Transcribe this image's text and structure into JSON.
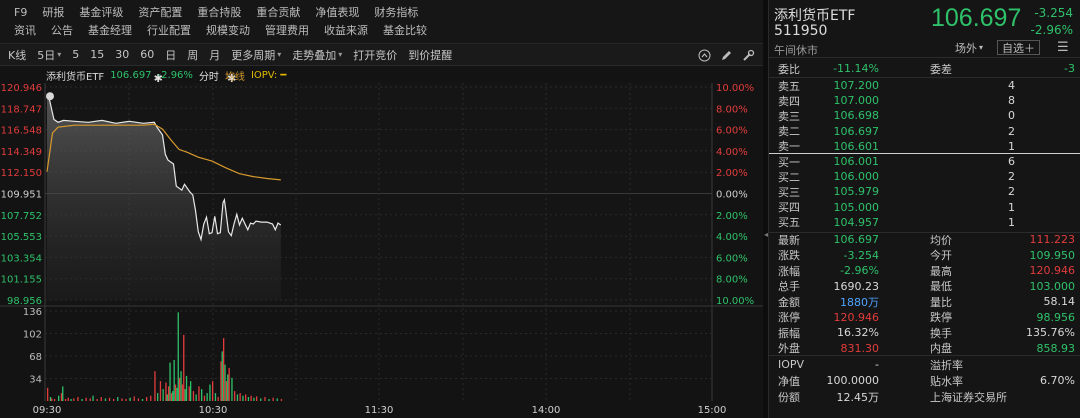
{
  "menu": {
    "row1": [
      "F9",
      "研报",
      "基金评级",
      "资产配置",
      "重合持股",
      "重合贡献",
      "净值表现",
      "财务指标"
    ],
    "row2": [
      "资讯",
      "公告",
      "基金经理",
      "行业配置",
      "规模变动",
      "管理费用",
      "收益来源",
      "基金比较"
    ]
  },
  "toolbar": {
    "items": [
      "K线",
      "5日",
      "5",
      "15",
      "30",
      "60",
      "日",
      "周",
      "月",
      "更多周期",
      "走势叠加",
      "打开竞价",
      "到价提醒"
    ],
    "icons": [
      "up-circle-icon",
      "draw-pen-icon",
      "settings-icon"
    ]
  },
  "chart": {
    "title": "添利货币ETF",
    "price": "106.697",
    "pct": "-2.96%",
    "mode": "分时",
    "avg_label": "均线",
    "iopv_label": "IOPV: ━",
    "y_left": [
      "120.946",
      "118.747",
      "116.548",
      "114.349",
      "112.150",
      "109.951",
      "107.752",
      "105.553",
      "103.354",
      "101.155",
      "98.956"
    ],
    "y_right": [
      "10.00%",
      "8.00%",
      "6.00%",
      "4.00%",
      "2.00%",
      "0.00%",
      "2.00%",
      "4.00%",
      "6.00%",
      "8.00%",
      "10.00%"
    ],
    "vol_axis": [
      "136",
      "102",
      "68",
      "34"
    ],
    "x_labels": [
      "09:30",
      "10:30",
      "11:30",
      "14:00",
      "15:00"
    ],
    "colors": {
      "price_line": "#e8e8e8",
      "avg_line": "#d79a2c",
      "up": "#e23c3c",
      "down": "#2fc16a",
      "grid": "#2a2a2a"
    }
  },
  "chart_data": {
    "type": "line",
    "title": "添利货币ETF",
    "x_labels": [
      "09:30",
      "10:30",
      "11:30",
      "14:00",
      "15:00"
    ],
    "ylim": [
      98.956,
      120.946
    ],
    "prev_close": 109.951,
    "series": [
      {
        "name": "分时",
        "points": [
          [
            0,
            120.2
          ],
          [
            2,
            119.5
          ],
          [
            5,
            117.6
          ],
          [
            8,
            117.3
          ],
          [
            12,
            117.5
          ],
          [
            20,
            117.4
          ],
          [
            30,
            117.3
          ],
          [
            40,
            117.5
          ],
          [
            50,
            117.2
          ],
          [
            60,
            117.4
          ],
          [
            70,
            117.2
          ],
          [
            78,
            117.3
          ],
          [
            80,
            116.8
          ],
          [
            84,
            116.0
          ],
          [
            86,
            114.0
          ],
          [
            88,
            113.4
          ],
          [
            92,
            113.0
          ],
          [
            94,
            110.7
          ],
          [
            98,
            110.3
          ],
          [
            100,
            110.9
          ],
          [
            104,
            110.1
          ],
          [
            106,
            109.8
          ],
          [
            108,
            108.2
          ],
          [
            110,
            106.0
          ],
          [
            112,
            105.2
          ],
          [
            114,
            106.8
          ],
          [
            116,
            107.5
          ],
          [
            118,
            105.8
          ],
          [
            120,
            105.9
          ],
          [
            122,
            107.6
          ],
          [
            124,
            105.8
          ],
          [
            126,
            105.9
          ],
          [
            128,
            109.0
          ],
          [
            129,
            109.3
          ],
          [
            130,
            108.2
          ],
          [
            132,
            106.0
          ],
          [
            134,
            105.6
          ],
          [
            136,
            106.8
          ],
          [
            138,
            107.8
          ],
          [
            140,
            106.7
          ],
          [
            142,
            107.4
          ],
          [
            144,
            106.8
          ],
          [
            146,
            106.2
          ],
          [
            148,
            106.9
          ],
          [
            150,
            106.8
          ],
          [
            152,
            107.1
          ],
          [
            156,
            107.0
          ],
          [
            160,
            107.0
          ],
          [
            164,
            106.8
          ],
          [
            166,
            106.2
          ],
          [
            168,
            106.9
          ],
          [
            170,
            106.7
          ]
        ]
      },
      {
        "name": "均线",
        "points": [
          [
            0,
            112.2
          ],
          [
            4,
            116.2
          ],
          [
            8,
            116.8
          ],
          [
            20,
            117.0
          ],
          [
            40,
            117.0
          ],
          [
            60,
            117.0
          ],
          [
            70,
            117.0
          ],
          [
            78,
            117.1
          ],
          [
            84,
            116.6
          ],
          [
            90,
            115.5
          ],
          [
            96,
            114.5
          ],
          [
            102,
            114.2
          ],
          [
            110,
            113.7
          ],
          [
            120,
            113.3
          ],
          [
            130,
            112.6
          ],
          [
            140,
            112.0
          ],
          [
            150,
            111.7
          ],
          [
            160,
            111.5
          ],
          [
            170,
            111.35
          ]
        ]
      }
    ],
    "volume": {
      "ylim": [
        0,
        136
      ],
      "bars": [
        [
          0,
          20,
          "up"
        ],
        [
          2,
          6,
          "down"
        ],
        [
          3,
          4,
          "up"
        ],
        [
          5,
          3,
          "up"
        ],
        [
          8,
          8,
          "down"
        ],
        [
          10,
          12,
          "up"
        ],
        [
          11,
          22,
          "down"
        ],
        [
          13,
          3,
          "up"
        ],
        [
          15,
          5,
          "up"
        ],
        [
          17,
          3,
          "down"
        ],
        [
          19,
          4,
          "up"
        ],
        [
          22,
          6,
          "up"
        ],
        [
          25,
          3,
          "down"
        ],
        [
          28,
          5,
          "up"
        ],
        [
          31,
          4,
          "up"
        ],
        [
          33,
          8,
          "down"
        ],
        [
          36,
          3,
          "up"
        ],
        [
          39,
          6,
          "up"
        ],
        [
          42,
          4,
          "down"
        ],
        [
          45,
          5,
          "up"
        ],
        [
          48,
          3,
          "up"
        ],
        [
          51,
          6,
          "down"
        ],
        [
          54,
          4,
          "up"
        ],
        [
          57,
          3,
          "up"
        ],
        [
          60,
          5,
          "down"
        ],
        [
          63,
          7,
          "up"
        ],
        [
          66,
          4,
          "up"
        ],
        [
          69,
          3,
          "down"
        ],
        [
          72,
          6,
          "up"
        ],
        [
          75,
          8,
          "up"
        ],
        [
          78,
          45,
          "up"
        ],
        [
          80,
          12,
          "down"
        ],
        [
          82,
          30,
          "up"
        ],
        [
          84,
          18,
          "down"
        ],
        [
          86,
          28,
          "up"
        ],
        [
          87,
          10,
          "down"
        ],
        [
          88,
          22,
          "up"
        ],
        [
          89,
          58,
          "down"
        ],
        [
          90,
          12,
          "up"
        ],
        [
          91,
          15,
          "down"
        ],
        [
          92,
          62,
          "down"
        ],
        [
          93,
          25,
          "up"
        ],
        [
          94,
          20,
          "down"
        ],
        [
          95,
          134,
          "down"
        ],
        [
          96,
          35,
          "up"
        ],
        [
          97,
          45,
          "down"
        ],
        [
          98,
          25,
          "up"
        ],
        [
          99,
          100,
          "up"
        ],
        [
          100,
          18,
          "down"
        ],
        [
          101,
          38,
          "down"
        ],
        [
          103,
          22,
          "up"
        ],
        [
          104,
          30,
          "down"
        ],
        [
          106,
          15,
          "up"
        ],
        [
          108,
          10,
          "down"
        ],
        [
          110,
          22,
          "up"
        ],
        [
          112,
          18,
          "down"
        ],
        [
          114,
          8,
          "up"
        ],
        [
          116,
          12,
          "down"
        ],
        [
          118,
          25,
          "down"
        ],
        [
          120,
          30,
          "up"
        ],
        [
          122,
          12,
          "down"
        ],
        [
          124,
          6,
          "up"
        ],
        [
          126,
          60,
          "up"
        ],
        [
          127,
          75,
          "down"
        ],
        [
          128,
          95,
          "up"
        ],
        [
          129,
          55,
          "down"
        ],
        [
          130,
          30,
          "up"
        ],
        [
          131,
          40,
          "down"
        ],
        [
          132,
          50,
          "up"
        ],
        [
          134,
          35,
          "down"
        ],
        [
          136,
          15,
          "up"
        ],
        [
          138,
          10,
          "down"
        ],
        [
          140,
          12,
          "up"
        ],
        [
          142,
          8,
          "down"
        ],
        [
          144,
          10,
          "up"
        ],
        [
          146,
          6,
          "down"
        ],
        [
          148,
          8,
          "up"
        ],
        [
          150,
          5,
          "down"
        ],
        [
          152,
          7,
          "up"
        ],
        [
          155,
          4,
          "down"
        ],
        [
          158,
          6,
          "up"
        ],
        [
          161,
          3,
          "down"
        ],
        [
          164,
          5,
          "up"
        ],
        [
          167,
          4,
          "down"
        ],
        [
          170,
          3,
          "up"
        ]
      ]
    }
  },
  "quote": {
    "name": "添利货币ETF",
    "code": "511950",
    "status": "午间休市",
    "price": "106.697",
    "change": "-3.254",
    "change_pct": "-2.96%",
    "btn_outside": "场外",
    "btn_add": "自选＋",
    "wei_bi_label": "委比",
    "wei_bi": "-11.14%",
    "wei_cha_label": "委差",
    "wei_cha": "-3",
    "asks": [
      {
        "label": "卖五",
        "price": "107.200",
        "vol": "4"
      },
      {
        "label": "卖四",
        "price": "107.000",
        "vol": "8"
      },
      {
        "label": "卖三",
        "price": "106.698",
        "vol": "0"
      },
      {
        "label": "卖二",
        "price": "106.697",
        "vol": "2"
      },
      {
        "label": "卖一",
        "price": "106.601",
        "vol": "1"
      }
    ],
    "bids": [
      {
        "label": "买一",
        "price": "106.001",
        "vol": "6"
      },
      {
        "label": "买二",
        "price": "106.000",
        "vol": "2"
      },
      {
        "label": "买三",
        "price": "105.979",
        "vol": "2"
      },
      {
        "label": "买四",
        "price": "105.000",
        "vol": "1"
      },
      {
        "label": "买五",
        "price": "104.957",
        "vol": "1"
      }
    ],
    "stats": [
      {
        "l1": "最新",
        "v1": "106.697",
        "c1": "down",
        "l2": "均价",
        "v2": "111.223",
        "c2": "up"
      },
      {
        "l1": "涨跌",
        "v1": "-3.254",
        "c1": "down",
        "l2": "今开",
        "v2": "109.950",
        "c2": "down"
      },
      {
        "l1": "涨幅",
        "v1": "-2.96%",
        "c1": "down",
        "l2": "最高",
        "v2": "120.946",
        "c2": "up"
      },
      {
        "l1": "总手",
        "v1": "1690.23",
        "c1": "neutral",
        "l2": "最低",
        "v2": "103.000",
        "c2": "down"
      },
      {
        "l1": "金额",
        "v1": "1880万",
        "c1": "blue",
        "l2": "量比",
        "v2": "58.14",
        "c2": "neutral"
      },
      {
        "l1": "涨停",
        "v1": "120.946",
        "c1": "up",
        "l2": "跌停",
        "v2": "98.956",
        "c2": "down"
      },
      {
        "l1": "振幅",
        "v1": "16.32%",
        "c1": "neutral",
        "l2": "换手",
        "v2": "135.76%",
        "c2": "neutral"
      },
      {
        "l1": "外盘",
        "v1": "831.30",
        "c1": "up",
        "l2": "内盘",
        "v2": "858.93",
        "c2": "down"
      }
    ],
    "iopv_label": "IOPV",
    "iopv_value": "-",
    "premium_label": "溢折率",
    "premium_value": "",
    "nav_label": "净值",
    "nav_value": "100.0000",
    "discount_label": "贴水率",
    "discount_value": "6.70%",
    "share_label": "份额",
    "share_value": "12.45万",
    "exchange": "上海证券交易所"
  }
}
